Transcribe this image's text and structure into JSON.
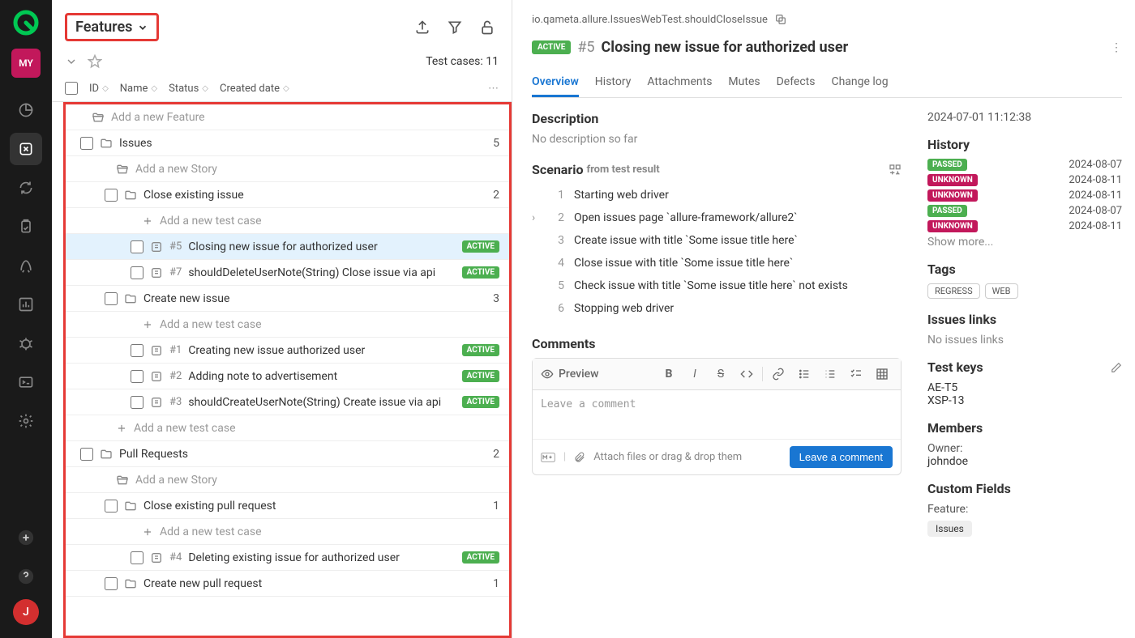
{
  "sidenav": {
    "avatar": "MY",
    "bottom_avatar": "J"
  },
  "header": {
    "dropdown_label": "Features",
    "test_cases_count": "Test cases: 11"
  },
  "columns": {
    "id": "ID",
    "name": "Name",
    "status": "Status",
    "created": "Created date"
  },
  "tree": {
    "add_feature": "Add a new Feature",
    "add_story": "Add a new Story",
    "add_tc": "Add a new test case",
    "groups": [
      {
        "name": "Issues",
        "count": "5",
        "stories": [
          {
            "name": "Close existing issue",
            "count": "2",
            "cases": [
              {
                "id": "#5",
                "name": "Closing new issue for authorized user",
                "badge": "ACTIVE",
                "selected": true
              },
              {
                "id": "#7",
                "name": "shouldDeleteUserNote(String) Close issue via api",
                "badge": "ACTIVE"
              }
            ]
          },
          {
            "name": "Create new issue",
            "count": "3",
            "cases": [
              {
                "id": "#1",
                "name": "Creating new issue authorized user",
                "badge": "ACTIVE"
              },
              {
                "id": "#2",
                "name": "Adding note to advertisement",
                "badge": "ACTIVE"
              },
              {
                "id": "#3",
                "name": "shouldCreateUserNote(String) Create issue via api",
                "badge": "ACTIVE"
              }
            ],
            "trailing_add": true
          }
        ]
      },
      {
        "name": "Pull Requests",
        "count": "2",
        "stories": [
          {
            "name": "Close existing pull request",
            "count": "1",
            "cases": [
              {
                "id": "#4",
                "name": "Deleting existing issue for authorized user",
                "badge": "ACTIVE"
              }
            ]
          },
          {
            "name": "Create new pull request",
            "count": "1",
            "cases": []
          }
        ]
      }
    ]
  },
  "details": {
    "path": "io.qameta.allure.IssuesWebTest.shouldCloseIssue",
    "badge": "ACTIVE",
    "id": "#5",
    "name": "Closing new issue for authorized user",
    "tabs": [
      "Overview",
      "History",
      "Attachments",
      "Mutes",
      "Defects",
      "Change log"
    ],
    "description_h": "Description",
    "description_v": "No description so far",
    "scenario_h": "Scenario",
    "scenario_sub": "from test result",
    "steps": [
      "Starting web driver",
      "Open issues page `allure-framework/allure2`",
      "Create issue with title `Some issue title here`",
      "Close issue with title `Some issue title here`",
      "Check issue with title `Some issue title here` not exists",
      "Stopping web driver"
    ],
    "comments_h": "Comments",
    "preview": "Preview",
    "comment_placeholder": "Leave a comment",
    "attach_hint": "Attach files or drag & drop them",
    "leave_btn": "Leave a comment",
    "timestamp": "2024-07-01 11:12:38",
    "history_h": "History",
    "history": [
      {
        "status": "PASSED",
        "cls": "pass",
        "date": "2024-08-07"
      },
      {
        "status": "UNKNOWN",
        "cls": "unk",
        "date": "2024-08-11"
      },
      {
        "status": "UNKNOWN",
        "cls": "unk",
        "date": "2024-08-11"
      },
      {
        "status": "PASSED",
        "cls": "pass",
        "date": "2024-08-07"
      },
      {
        "status": "UNKNOWN",
        "cls": "unk",
        "date": "2024-08-11"
      }
    ],
    "show_more": "Show more...",
    "tags_h": "Tags",
    "tags": [
      "REGRESS",
      "WEB"
    ],
    "issues_h": "Issues links",
    "issues_v": "No issues links",
    "keys_h": "Test keys",
    "keys": [
      "AE-T5",
      "XSP-13"
    ],
    "members_h": "Members",
    "owner_label": "Owner:",
    "owner_v": "johndoe",
    "custom_h": "Custom Fields",
    "cf_label": "Feature:",
    "cf_value": "Issues"
  }
}
